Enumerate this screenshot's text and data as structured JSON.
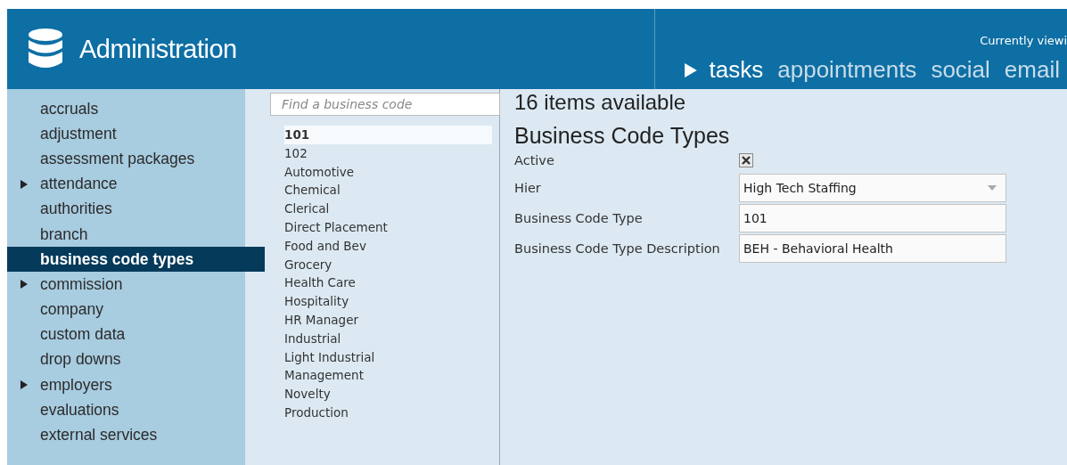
{
  "header": {
    "title": "Administration",
    "viewing": "Currently viewi",
    "nav": [
      {
        "label": "tasks",
        "selected": true
      },
      {
        "label": "appointments",
        "selected": false
      },
      {
        "label": "social",
        "selected": false
      },
      {
        "label": "email",
        "selected": false
      }
    ]
  },
  "sidebar": {
    "items": [
      {
        "label": "accruals",
        "expandable": false,
        "selected": false
      },
      {
        "label": "adjustment",
        "expandable": false,
        "selected": false
      },
      {
        "label": "assessment packages",
        "expandable": false,
        "selected": false
      },
      {
        "label": "attendance",
        "expandable": true,
        "selected": false
      },
      {
        "label": "authorities",
        "expandable": false,
        "selected": false
      },
      {
        "label": "branch",
        "expandable": false,
        "selected": false
      },
      {
        "label": "business code types",
        "expandable": false,
        "selected": true
      },
      {
        "label": "commission",
        "expandable": true,
        "selected": false
      },
      {
        "label": "company",
        "expandable": false,
        "selected": false
      },
      {
        "label": "custom data",
        "expandable": false,
        "selected": false
      },
      {
        "label": "drop downs",
        "expandable": false,
        "selected": false
      },
      {
        "label": "employers",
        "expandable": true,
        "selected": false
      },
      {
        "label": "evaluations",
        "expandable": false,
        "selected": false
      },
      {
        "label": "external services",
        "expandable": false,
        "selected": false
      }
    ]
  },
  "codes": {
    "search": {
      "placeholder": "Find a business code"
    },
    "items": [
      {
        "label": "101",
        "selected": true
      },
      {
        "label": "102",
        "selected": false
      },
      {
        "label": "Automotive",
        "selected": false
      },
      {
        "label": "Chemical",
        "selected": false
      },
      {
        "label": "Clerical",
        "selected": false
      },
      {
        "label": "Direct Placement",
        "selected": false
      },
      {
        "label": "Food and Bev",
        "selected": false
      },
      {
        "label": "Grocery",
        "selected": false
      },
      {
        "label": "Health Care",
        "selected": false
      },
      {
        "label": "Hospitality",
        "selected": false
      },
      {
        "label": "HR Manager",
        "selected": false
      },
      {
        "label": "Industrial",
        "selected": false
      },
      {
        "label": "Light Industrial",
        "selected": false
      },
      {
        "label": "Management",
        "selected": false
      },
      {
        "label": "Novelty",
        "selected": false
      },
      {
        "label": "Production",
        "selected": false
      }
    ]
  },
  "detail": {
    "count": "16 items available",
    "title": "Business Code Types",
    "fields": [
      {
        "kind": "checkbox",
        "label": "Active",
        "checked": true
      },
      {
        "kind": "select",
        "label": "Hier",
        "value": "High Tech Staffing"
      },
      {
        "kind": "text",
        "label": "Business Code Type",
        "value": "101"
      },
      {
        "kind": "text",
        "label": "Business Code Type Description",
        "value": "BEH - Behavioral Health"
      }
    ]
  }
}
